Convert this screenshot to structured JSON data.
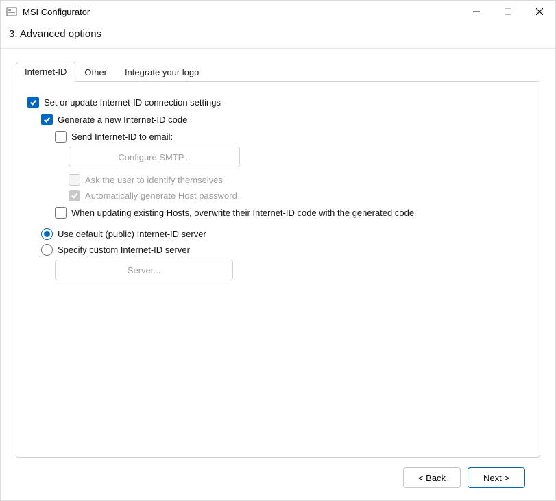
{
  "window": {
    "title": "MSI Configurator"
  },
  "step": {
    "header": "3. Advanced options"
  },
  "tabs": {
    "internet_id": "Internet-ID",
    "other": "Other",
    "integrate_logo": "Integrate your logo"
  },
  "internet_id_panel": {
    "set_or_update": "Set or update Internet-ID connection settings",
    "generate_new": "Generate a new Internet-ID code",
    "send_email": "Send Internet-ID to email:",
    "configure_smtp": "Configure SMTP...",
    "ask_identify": "Ask the user to identify themselves",
    "auto_gen_pw": "Automatically generate Host password",
    "overwrite": "When updating existing Hosts, overwrite their Internet-ID code with the generated code",
    "use_default": "Use default (public) Internet-ID server",
    "specify_custom": "Specify custom Internet-ID server",
    "server_btn": "Server..."
  },
  "footer": {
    "back_prefix": "< ",
    "back_u": "B",
    "back_rest": "ack",
    "next_u": "N",
    "next_rest": "ext >"
  }
}
